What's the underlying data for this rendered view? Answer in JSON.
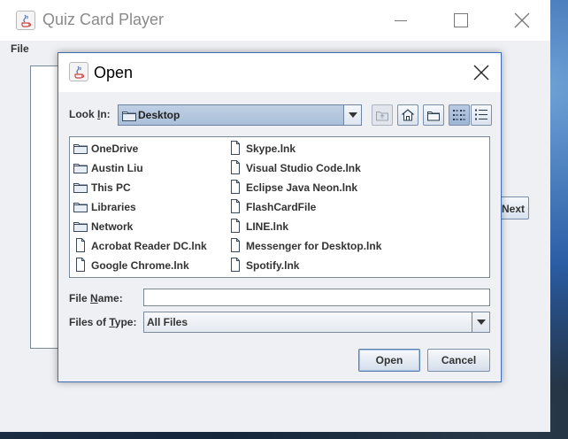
{
  "main_window": {
    "title": "Quiz Card Player",
    "menu": {
      "file": "File"
    },
    "side_button_label": "Next Question"
  },
  "dialog": {
    "title": "Open",
    "look_in": {
      "label_prefix": "Look ",
      "label_mnemonic": "I",
      "label_suffix": "n:",
      "value": "Desktop"
    },
    "toolbar": [
      {
        "name": "up-one-level",
        "enabled": false
      },
      {
        "name": "home",
        "enabled": true
      },
      {
        "name": "create-new-folder",
        "enabled": true
      },
      {
        "name": "list-view",
        "enabled": true,
        "selected": true
      },
      {
        "name": "details-view",
        "enabled": true,
        "selected": false
      }
    ],
    "files": {
      "column1": [
        {
          "name": "OneDrive",
          "type": "folder"
        },
        {
          "name": "Austin Liu",
          "type": "folder"
        },
        {
          "name": "This PC",
          "type": "folder"
        },
        {
          "name": "Libraries",
          "type": "folder"
        },
        {
          "name": "Network",
          "type": "folder"
        },
        {
          "name": "Acrobat Reader DC.lnk",
          "type": "file"
        },
        {
          "name": "Google Chrome.lnk",
          "type": "file"
        }
      ],
      "column2": [
        {
          "name": "Skype.lnk",
          "type": "file"
        },
        {
          "name": "Visual Studio Code.lnk",
          "type": "file"
        },
        {
          "name": "Eclipse Java Neon.lnk",
          "type": "file"
        },
        {
          "name": "FlashCardFile",
          "type": "file"
        },
        {
          "name": "LINE.lnk",
          "type": "file"
        },
        {
          "name": "Messenger for Desktop.lnk",
          "type": "file"
        },
        {
          "name": "Spotify.lnk",
          "type": "file"
        }
      ]
    },
    "file_name": {
      "label_prefix": "File ",
      "label_mnemonic": "N",
      "label_suffix": "ame:",
      "value": ""
    },
    "files_of_type": {
      "label_prefix": "Files of ",
      "label_mnemonic": "T",
      "label_suffix": "ype:",
      "value": "All Files"
    },
    "buttons": {
      "open": "Open",
      "cancel": "Cancel"
    }
  },
  "colors": {
    "dialog_border": "#3d6eb4",
    "combo_selected": "#a9bfd9",
    "panel_bg": "#eef0f4"
  }
}
